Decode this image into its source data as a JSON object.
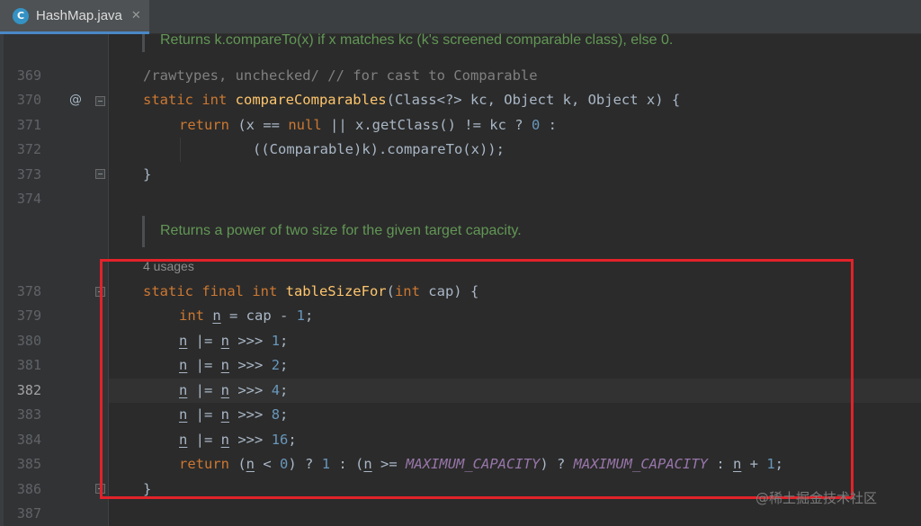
{
  "tab": {
    "filename": "HashMap.java",
    "icon_letter": "C",
    "close_glyph": "✕"
  },
  "doc1": "Returns k.compareTo(x) if x matches kc (k's screened comparable class), else 0.",
  "doc2": "Returns a power of two size for the given target capacity.",
  "usages": "4 usages",
  "gutter_mark": "@",
  "line_numbers": {
    "l369": "369",
    "l370": "370",
    "l371": "371",
    "l372": "372",
    "l373": "373",
    "l374": "374",
    "l378": "378",
    "l379": "379",
    "l380": "380",
    "l381": "381",
    "l382": "382",
    "l383": "383",
    "l384": "384",
    "l385": "385",
    "l386": "386",
    "l387": "387"
  },
  "code": {
    "c369_a": "/rawtypes, unchecked/",
    "c369_b": " // for cast to Comparable",
    "c370_kw": "static int ",
    "c370_fn": "compareComparables",
    "c370_rest": "(Class<?> kc, Object k, Object x) {",
    "c371_kw": "return",
    "c371_a": " (x == ",
    "c371_null": "null",
    "c371_b": " || x.getClass() != kc ? ",
    "c371_zero": "0",
    "c371_c": " :",
    "c372": "((Comparable)k).compareTo(x));",
    "c373": "}",
    "c378_kw": "static final int ",
    "c378_fn": "tableSizeFor",
    "c378_a": "(",
    "c378_int": "int",
    "c378_b": " cap) {",
    "c379_kw": "int ",
    "c379_n": "n",
    "c379_a": " = cap - ",
    "c379_num": "1",
    "c379_b": ";",
    "n": "n",
    "or_shift": " |= ",
    "shift": " >>> ",
    "semi": ";",
    "s1": "1",
    "s2": "2",
    "s4": "4",
    "s8": "8",
    "s16": "16",
    "c385_kw": "return",
    "c385_a": " (",
    "c385_b": " < ",
    "c385_zero": "0",
    "c385_c": ") ? ",
    "c385_one": "1",
    "c385_d": " : (",
    "c385_e": " >= ",
    "max_cap": "MAXIMUM_CAPACITY",
    "c385_f": ") ? ",
    "c385_g": " : ",
    "c385_h": " + ",
    "c385_one2": "1",
    "c385_i": ";",
    "c386": "}"
  },
  "watermark": "@稀土掘金技术社区",
  "colors": {
    "keyword": "#cc7832",
    "function": "#ffc66d",
    "number": "#6897bb",
    "constant": "#9876aa",
    "doc": "#629755",
    "highlight": "#e3222a"
  }
}
